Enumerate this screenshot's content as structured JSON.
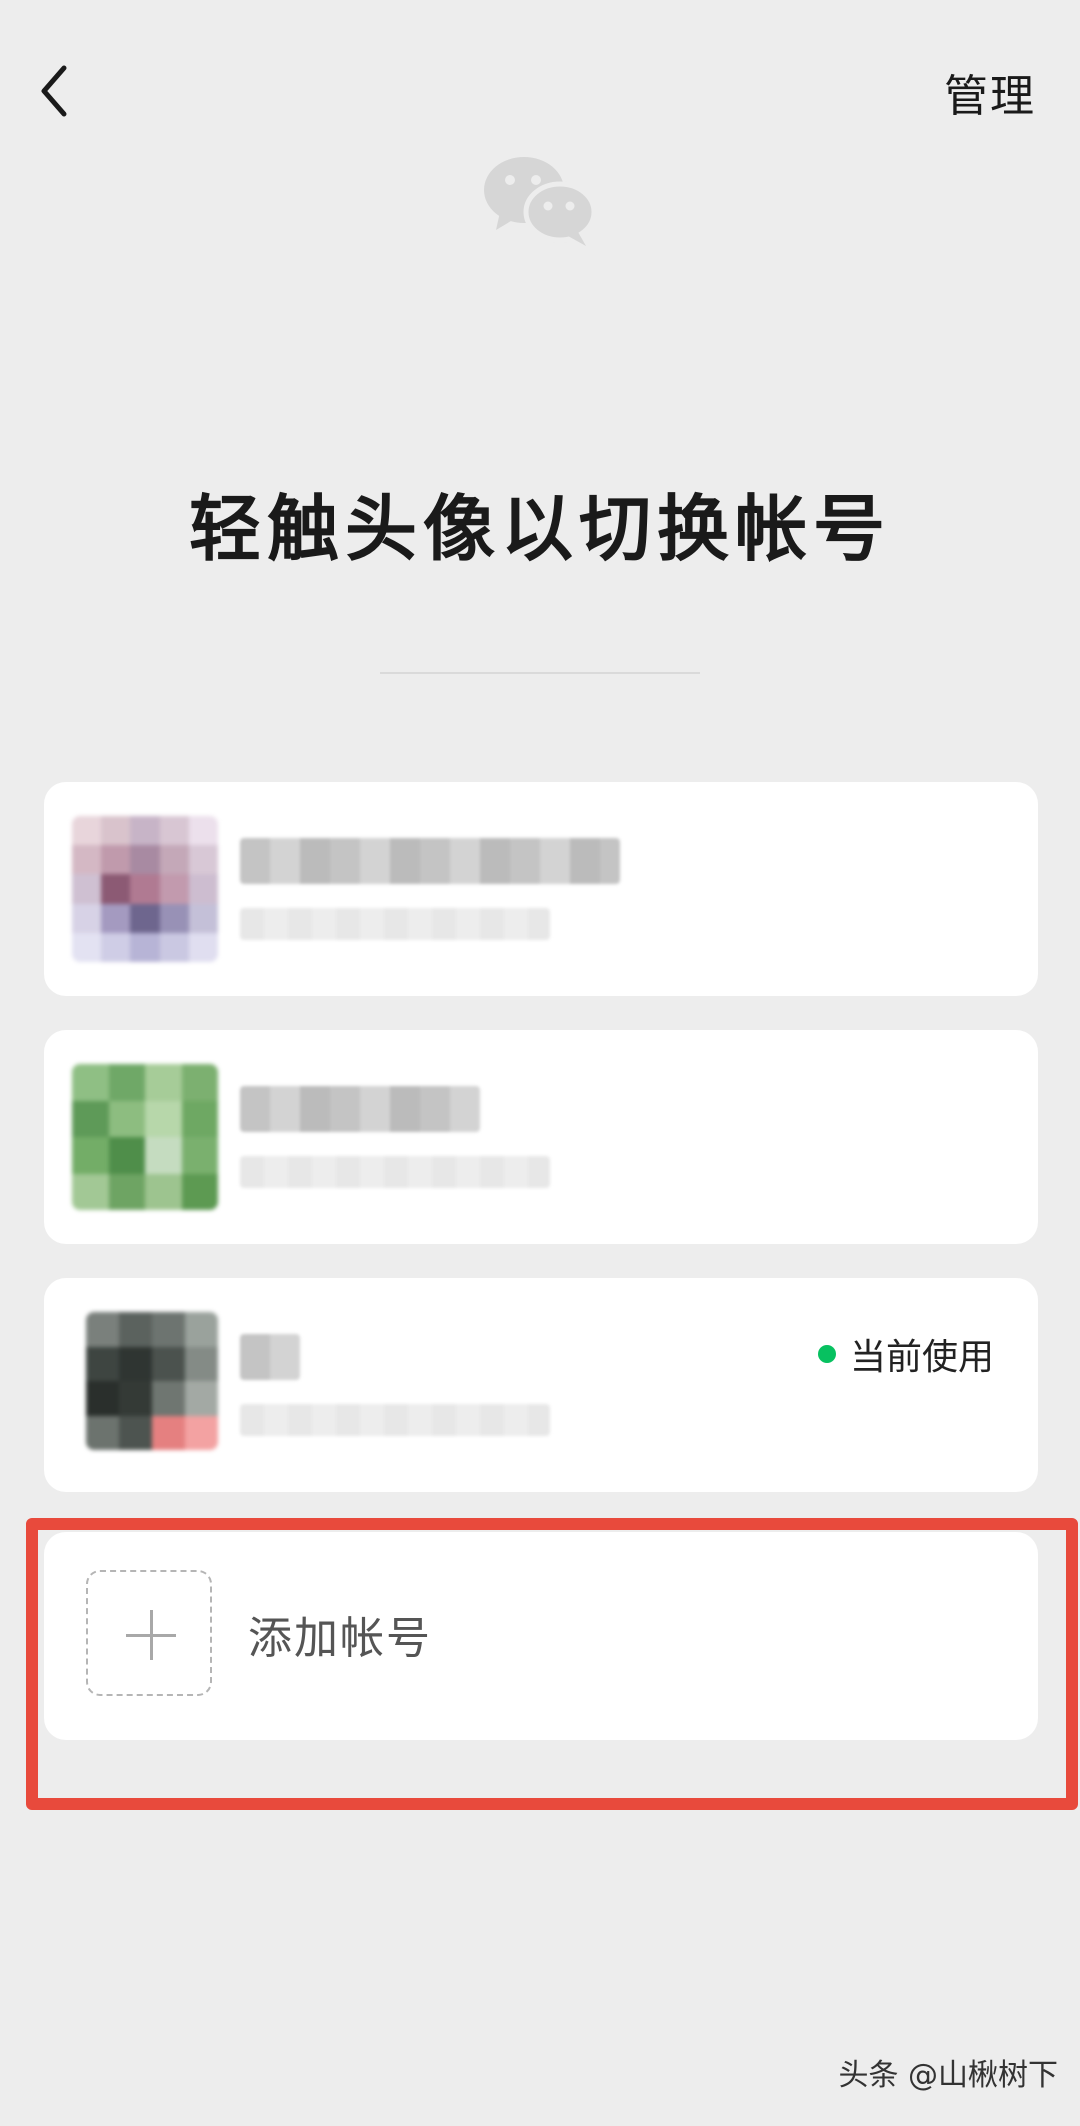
{
  "header": {
    "back_icon": "chevron-left-icon",
    "manage_label": "管理",
    "logo_icon": "wechat-logo-icon"
  },
  "title": "轻触头像以切换帐号",
  "accounts": [
    {
      "status": ""
    },
    {
      "status": ""
    },
    {
      "status": "当前使用",
      "status_color": "#07c160"
    }
  ],
  "add_account": {
    "label": "添加帐号",
    "icon": "plus-icon"
  },
  "colors": {
    "background": "#ededed",
    "card": "#ffffff",
    "accent_green": "#07c160",
    "highlight_red": "#e84a3c"
  },
  "watermark": "头条 @山楸树下"
}
